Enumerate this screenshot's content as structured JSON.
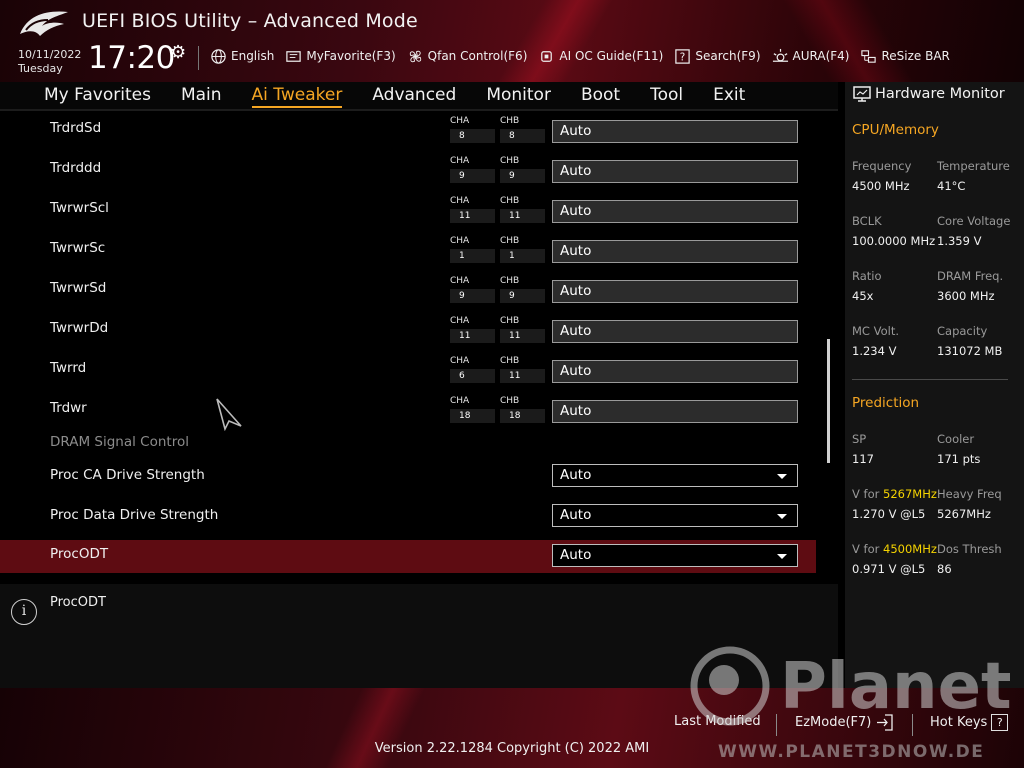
{
  "header": {
    "title": "UEFI BIOS Utility – Advanced Mode",
    "date": "10/11/2022",
    "day": "Tuesday",
    "time": "17:20",
    "toolbar": [
      {
        "label": "English",
        "icon": "globe-icon"
      },
      {
        "label": "MyFavorite(F3)",
        "icon": "favorite-icon"
      },
      {
        "label": "Qfan Control(F6)",
        "icon": "fan-icon"
      },
      {
        "label": "AI OC Guide(F11)",
        "icon": "chip-icon"
      },
      {
        "label": "Search(F9)",
        "icon": "search-icon"
      },
      {
        "label": "AURA(F4)",
        "icon": "aura-icon"
      },
      {
        "label": "ReSize BAR",
        "icon": "resize-bar-icon"
      }
    ]
  },
  "nav": {
    "tabs": [
      "My Favorites",
      "Main",
      "Ai Tweaker",
      "Advanced",
      "Monitor",
      "Boot",
      "Tool",
      "Exit"
    ],
    "active": "Ai Tweaker"
  },
  "settings": {
    "timings": [
      {
        "name": "TrdrdSd",
        "cha": "8",
        "chb": "8",
        "value": "Auto"
      },
      {
        "name": "Trdrddd",
        "cha": "9",
        "chb": "9",
        "value": "Auto"
      },
      {
        "name": "TwrwrScl",
        "cha": "11",
        "chb": "11",
        "value": "Auto"
      },
      {
        "name": "TwrwrSc",
        "cha": "1",
        "chb": "1",
        "value": "Auto"
      },
      {
        "name": "TwrwrSd",
        "cha": "9",
        "chb": "9",
        "value": "Auto"
      },
      {
        "name": "TwrwrDd",
        "cha": "11",
        "chb": "11",
        "value": "Auto"
      },
      {
        "name": "Twrrd",
        "cha": "6",
        "chb": "11",
        "value": "Auto"
      },
      {
        "name": "Trdwr",
        "cha": "18",
        "chb": "18",
        "value": "Auto"
      }
    ],
    "channel_a_label": "CHA",
    "channel_b_label": "CHB",
    "section_label": "DRAM Signal Control",
    "dropdowns": [
      {
        "name": "Proc CA Drive Strength",
        "value": "Auto"
      },
      {
        "name": "Proc Data Drive Strength",
        "value": "Auto"
      },
      {
        "name": "ProcODT",
        "value": "Auto",
        "selected": true
      }
    ]
  },
  "help": {
    "text": "ProcODT"
  },
  "hardware_monitor": {
    "title": "Hardware Monitor",
    "cpu_memory": {
      "section": "CPU/Memory",
      "frequency_label": "Frequency",
      "frequency": "4500 MHz",
      "temperature_label": "Temperature",
      "temperature": "41°C",
      "bclk_label": "BCLK",
      "bclk": "100.0000 MHz",
      "core_voltage_label": "Core Voltage",
      "core_voltage": "1.359 V",
      "ratio_label": "Ratio",
      "ratio": "45x",
      "dram_freq_label": "DRAM Freq.",
      "dram_freq": "3600 MHz",
      "mc_volt_label": "MC Volt.",
      "mc_volt": "1.234 V",
      "capacity_label": "Capacity",
      "capacity": "131072 MB"
    },
    "prediction": {
      "section": "Prediction",
      "sp_label": "SP",
      "sp": "117",
      "cooler_label": "Cooler",
      "cooler": "171 pts",
      "v_for_label": "V for ",
      "v_freq1": "5267MHz",
      "v_freq1_value": "1.270 V @L5",
      "heavy_freq_label": "Heavy Freq",
      "heavy_freq": "5267MHz",
      "v_freq2": "4500MHz",
      "v_freq2_value": "0.971 V @L5",
      "dos_thresh_label": "Dos Thresh",
      "dos_thresh": "86"
    }
  },
  "footer": {
    "last_modified": "Last Modified",
    "ezmode": "EzMode(F7)",
    "hot_keys": "Hot Keys",
    "hot_keys_key": "?",
    "version": "Version 2.22.1284 Copyright (C) 2022 AMI"
  },
  "watermark": {
    "brand": "Planet",
    "url": "WWW.PLANET3DNOW.DE"
  },
  "colors": {
    "accent": "#f5a623",
    "selected_row": "#5e0c12",
    "highlight": "#f5d300"
  }
}
